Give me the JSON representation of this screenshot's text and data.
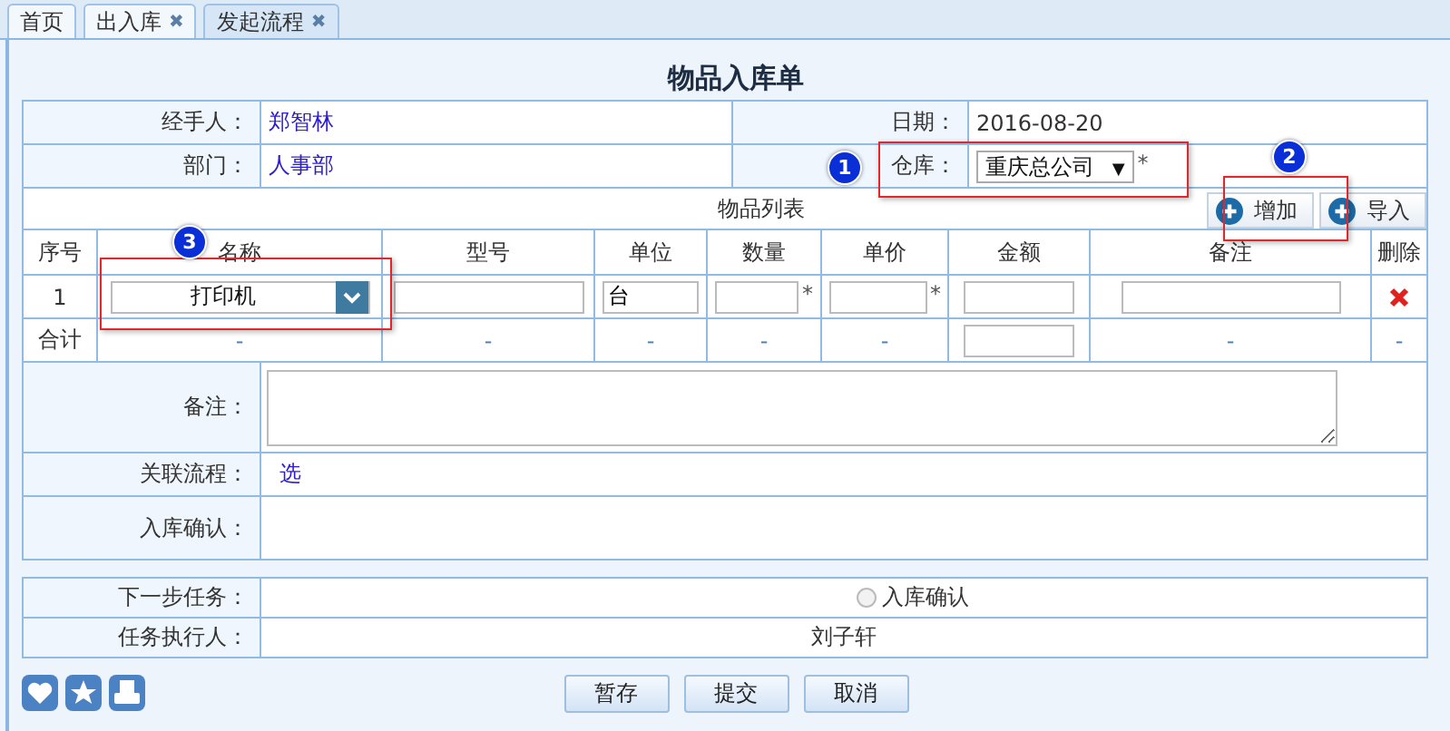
{
  "tabs": [
    {
      "label": "首页",
      "closable": false,
      "selected": false
    },
    {
      "label": "出入库",
      "closable": true,
      "selected": false
    },
    {
      "label": "发起流程",
      "closable": true,
      "selected": true
    }
  ],
  "close_glyph": "✖",
  "title": "物品入库单",
  "handler": {
    "label": "经手人：",
    "value": "郑智林"
  },
  "date": {
    "label": "日期：",
    "value": "2016-08-20"
  },
  "department": {
    "label": "部门：",
    "value": "人事部"
  },
  "warehouse": {
    "label": "仓库：",
    "value": "重庆总公司",
    "caret": "▼",
    "mark": "*"
  },
  "items": {
    "title": "物品列表",
    "add_button": "增加",
    "import_button": "导入",
    "columns": [
      "序号",
      "名称",
      "型号",
      "单位",
      "数量",
      "单价",
      "金额",
      "备注",
      "删除"
    ],
    "rows": [
      {
        "cells": [
          {
            "kind": "text",
            "text": "1"
          },
          {
            "kind": "select",
            "value": "打印机"
          },
          {
            "kind": "input"
          },
          {
            "kind": "input",
            "value": "台"
          },
          {
            "kind": "input",
            "mark": "*"
          },
          {
            "kind": "input",
            "mark": "*"
          },
          {
            "kind": "input"
          },
          {
            "kind": "input"
          },
          {
            "kind": "delete"
          }
        ]
      }
    ],
    "totals": [
      {
        "kind": "text",
        "text": "合计"
      },
      {
        "kind": "text",
        "text": "-"
      },
      {
        "kind": "text",
        "text": "-"
      },
      {
        "kind": "text",
        "text": "-"
      },
      {
        "kind": "text",
        "text": "-"
      },
      {
        "kind": "text",
        "text": "-"
      },
      {
        "kind": "input"
      },
      {
        "kind": "text",
        "text": "-"
      },
      {
        "kind": "text",
        "text": "-"
      }
    ]
  },
  "remarks": {
    "label": "备注："
  },
  "related_flow": {
    "label": "关联流程：",
    "link": "选"
  },
  "confirm": {
    "label": "入库确认："
  },
  "next_task": {
    "label": "下一步任务：",
    "option": "入库确认",
    "selected": false
  },
  "assignee": {
    "label": "任务执行人：",
    "value": "刘子轩"
  },
  "buttons": [
    "暂存",
    "提交",
    "取消"
  ],
  "callouts": [
    "1",
    "2",
    "3"
  ]
}
